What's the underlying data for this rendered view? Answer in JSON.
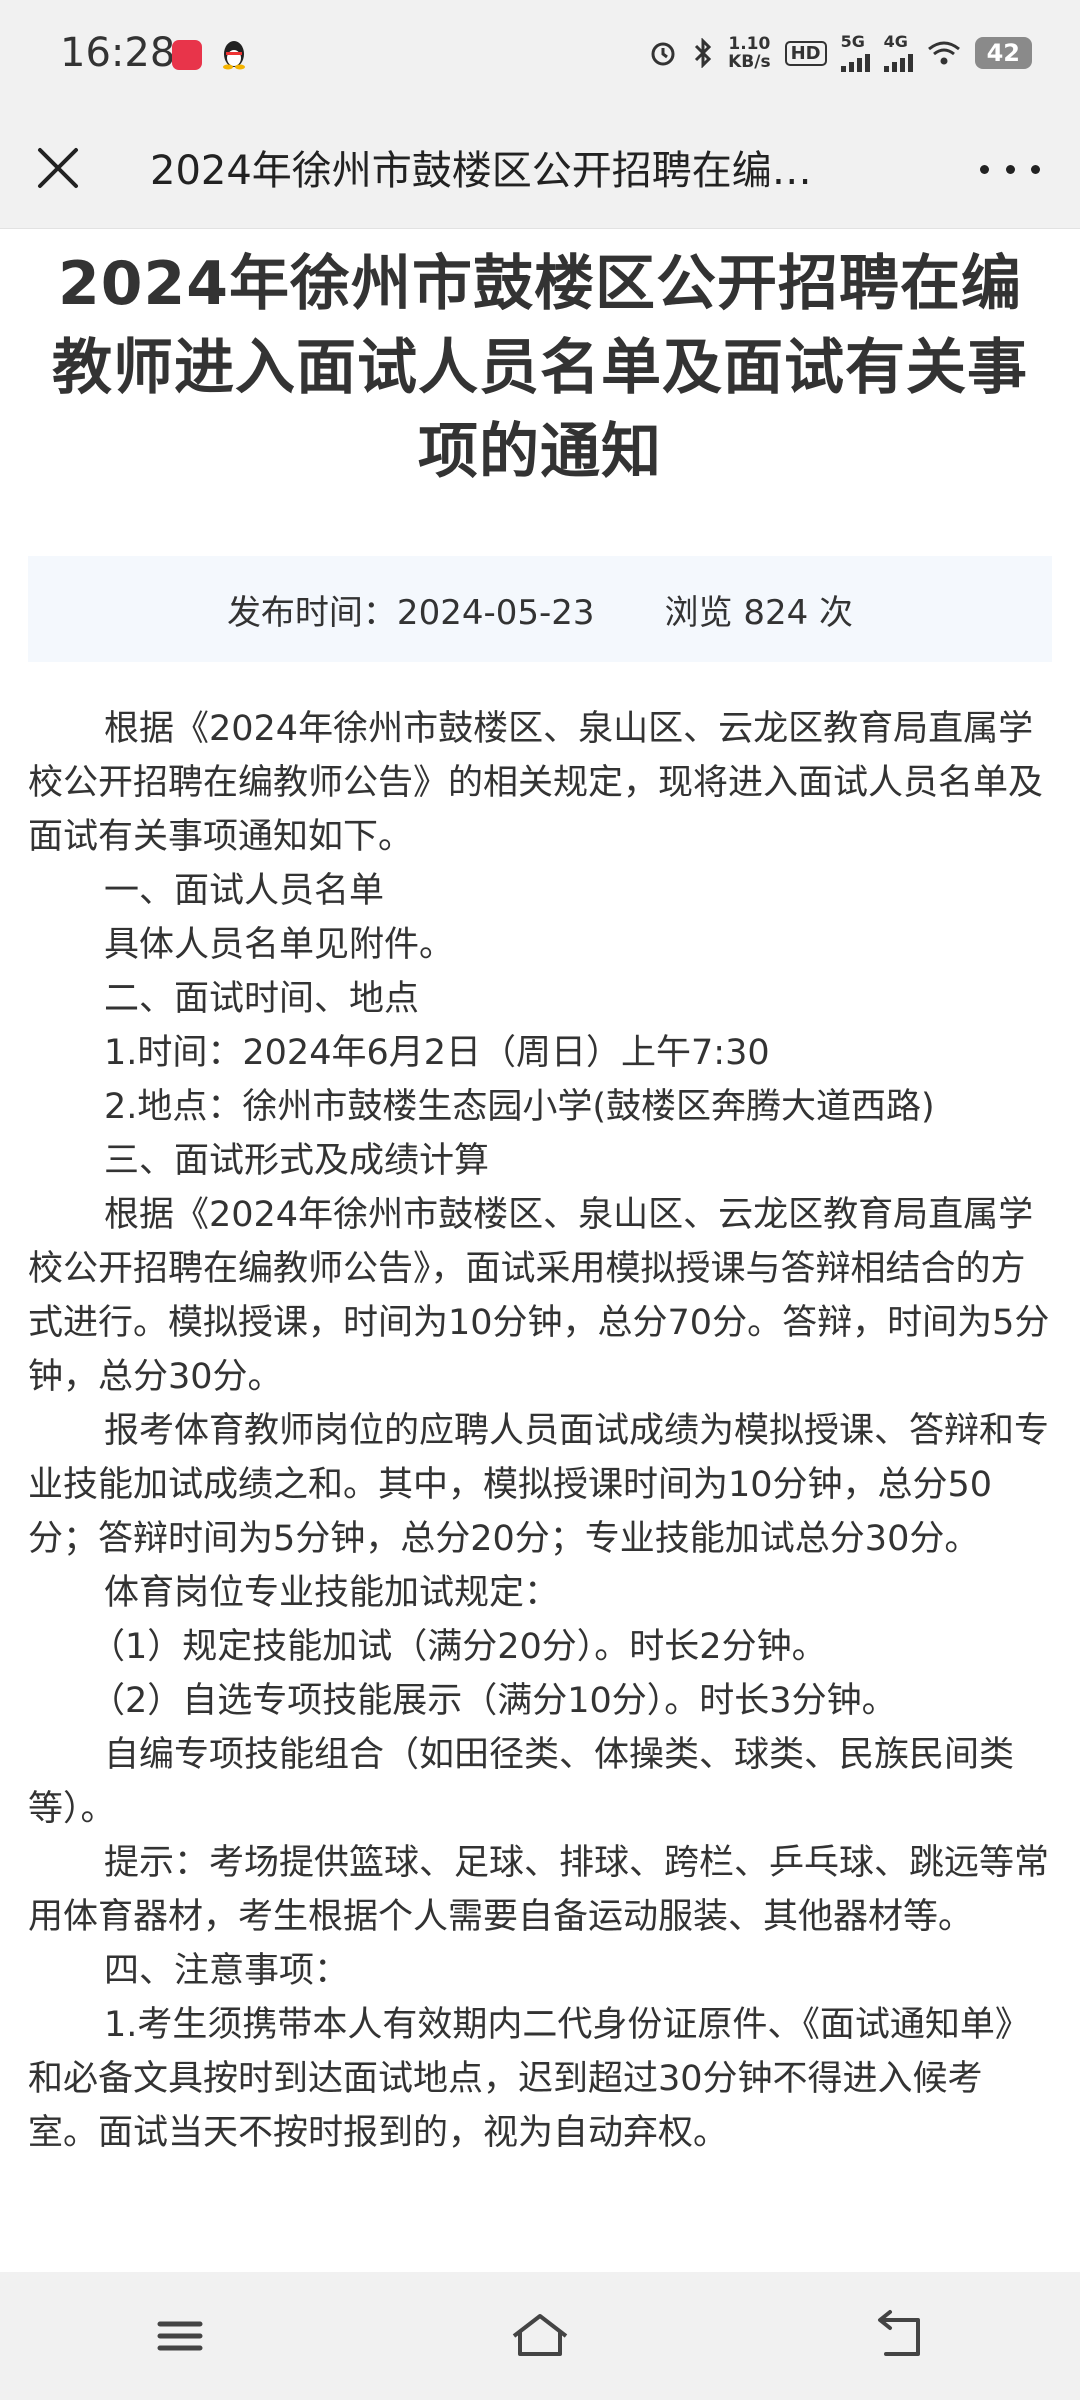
{
  "status_bar": {
    "time": "16:28",
    "net_speed_value": "1.10",
    "net_speed_unit": "KB/s",
    "hd_label": "HD",
    "sig1_label": "5G",
    "sig2_label": "4G",
    "battery": "42"
  },
  "header": {
    "title": "2024年徐州市鼓楼区公开招聘在编…"
  },
  "article": {
    "title": "2024年徐州市鼓楼区公开招聘在编教师进入面试人员名单及面试有关事项的通知",
    "publish_time": "发布时间：2024-05-23",
    "views": "浏览 824 次",
    "paragraphs": [
      "根据《2024年徐州市鼓楼区、泉山区、云龙区教育局直属学校公开招聘在编教师公告》的相关规定，现将进入面试人员名单及面试有关事项通知如下。",
      "一、面试人员名单",
      "具体人员名单见附件。",
      "二、面试时间、地点",
      "1.时间：2024年6月2日（周日）上午7:30",
      "2.地点：徐州市鼓楼生态园小学(鼓楼区奔腾大道西路)",
      "三、面试形式及成绩计算",
      "根据《2024年徐州市鼓楼区、泉山区、云龙区教育局直属学校公开招聘在编教师公告》，面试采用模拟授课与答辩相结合的方式进行。模拟授课，时间为10分钟，总分70分。答辩，时间为5分钟，总分30分。",
      "报考体育教师岗位的应聘人员面试成绩为模拟授课、答辩和专业技能加试成绩之和。其中，模拟授课时间为10分钟，总分50分；答辩时间为5分钟，总分20分；专业技能加试总分30分。",
      "体育岗位专业技能加试规定：",
      "（1）规定技能加试（满分20分）。时长2分钟。",
      "（2）自选专项技能展示（满分10分）。时长3分钟。",
      "自编专项技能组合（如田径类、体操类、球类、民族民间类等）。",
      "提示：考场提供篮球、足球、排球、跨栏、乒乓球、跳远等常用体育器材，考生根据个人需要自备运动服装、其他器材等。",
      "四、注意事项：",
      "1.考生须携带本人有效期内二代身份证原件、《面试通知单》和必备文具按时到达面试地点，迟到超过30分钟不得进入候考室。面试当天不按时报到的，视为自动弃权。"
    ]
  },
  "icons": {
    "close": "close-icon",
    "more": "more-icon",
    "menu": "menu-icon",
    "home": "home-icon",
    "back": "back-icon"
  },
  "colors": {
    "bar_bg": "#f1f1f1",
    "meta_bg": "#f4f8fd",
    "text": "#333333"
  }
}
